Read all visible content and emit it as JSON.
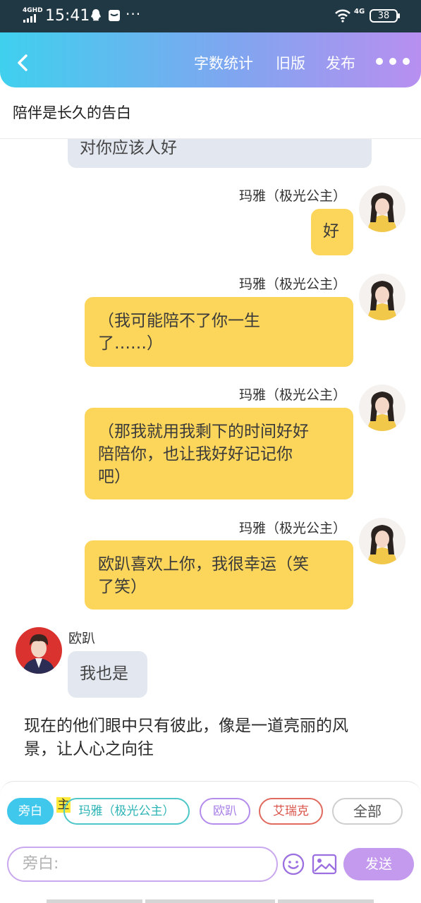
{
  "status_bar": {
    "network": "4GHD",
    "time": "15:41",
    "cell_label": "4G",
    "battery": "38"
  },
  "app_bar": {
    "word_count_label": "字数统计",
    "old_version_label": "旧版",
    "publish_label": "发布"
  },
  "document": {
    "title": "陪伴是长久的告白"
  },
  "messages": [
    {
      "side": "left",
      "text": "对你应该人好"
    },
    {
      "side": "right",
      "speaker": "玛雅（极光公主）",
      "text": "好"
    },
    {
      "side": "right",
      "speaker": "玛雅（极光公主）",
      "lines": [
        "（我可能陪不了你一生",
        "了……）"
      ]
    },
    {
      "side": "right",
      "speaker": "玛雅（极光公主）",
      "lines": [
        "（那我就用我剩下的时间好好",
        "陪陪你，也让我好好记记你",
        "吧）"
      ]
    },
    {
      "side": "right",
      "speaker": "玛雅（极光公主）",
      "lines": [
        "欧趴喜欢上你，我很幸运（笑",
        "了笑）"
      ]
    },
    {
      "side": "left",
      "speaker": "欧趴",
      "text": "我也是"
    }
  ],
  "narration": {
    "lines": [
      "现在的他们眼中只有彼此，像是一道亮丽的风",
      "景，让人心之向往"
    ]
  },
  "role_chips": {
    "narrator": "旁白",
    "main_tag": "主",
    "maya": "玛雅（极光公主）",
    "opa": "欧趴",
    "eric": "艾瑞克",
    "all": "全部"
  },
  "composer": {
    "placeholder": "旁白:",
    "send_label": "发送"
  },
  "colors": {
    "header_gradient": [
      "#3fd0ee",
      "#7fa6f0",
      "#b88ff0"
    ],
    "right_bubble": "#fcd55b",
    "left_bubble": "#e3e8f0",
    "send_button": "#c49aee"
  }
}
